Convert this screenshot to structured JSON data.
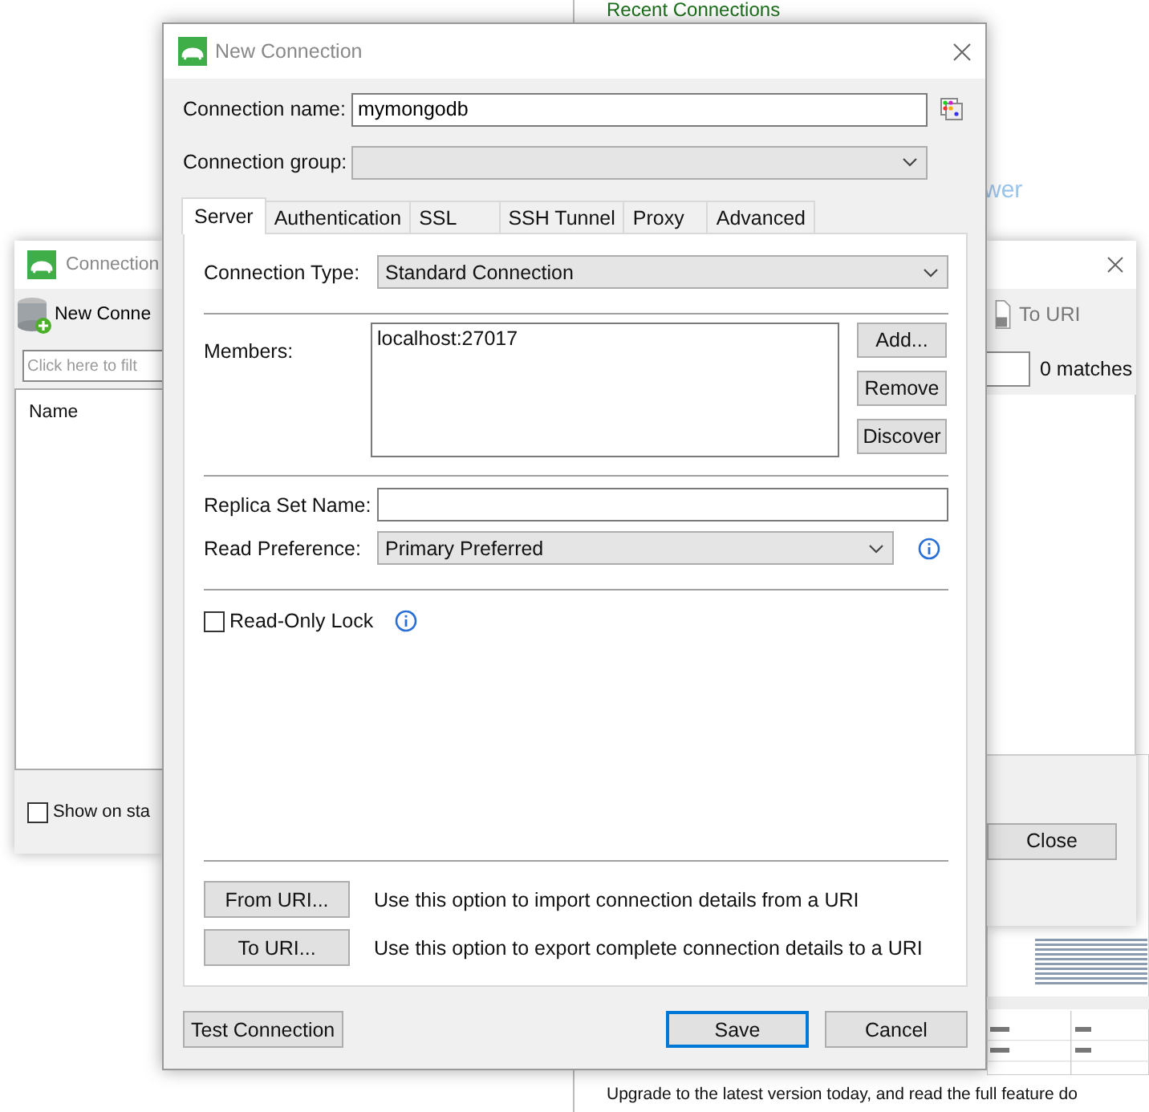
{
  "background_page": {
    "heading": "Recent Connections",
    "link": "wer",
    "footer_text": "Upgrade to the latest version today, and read the full feature do"
  },
  "connections_window": {
    "title": "Connection",
    "toolbar_button": "New Conne",
    "filter": {
      "placeholder": "Click here to filt"
    },
    "column": "Name",
    "show_on_startup": {
      "label": "Show on sta",
      "checked": false
    }
  },
  "uri_window": {
    "toolbar_button": "To URI",
    "matches": "0 matches",
    "close_button": "Close"
  },
  "dialog": {
    "title": "New Connection",
    "connection_name": {
      "label": "Connection name:",
      "value": "mymongodb"
    },
    "connection_group": {
      "label": "Connection group:"
    },
    "tabs": [
      {
        "label": "Server",
        "selected": true
      },
      {
        "label": "Authentication",
        "selected": false
      },
      {
        "label": "SSL",
        "selected": false
      },
      {
        "label": "SSH Tunnel",
        "selected": false
      },
      {
        "label": "Proxy",
        "selected": false
      },
      {
        "label": "Advanced",
        "selected": false
      }
    ],
    "connection_type": {
      "label": "Connection Type:",
      "value": "Standard Connection"
    },
    "members": {
      "label": "Members:",
      "items": [
        "localhost:27017"
      ],
      "buttons": [
        "Add...",
        "Remove",
        "Discover"
      ]
    },
    "replica_set_name": {
      "label": "Replica Set Name:"
    },
    "read_preference": {
      "label": "Read Preference:",
      "value": "Primary Preferred"
    },
    "read_only_lock": {
      "label": "Read-Only Lock",
      "checked": false
    },
    "uri_actions": [
      {
        "button": "From URI...",
        "description": "Use this option to import connection details from a URI"
      },
      {
        "button": "To URI...",
        "description": "Use this option to export complete connection details to a URI"
      }
    ],
    "buttons": [
      {
        "label": "Test Connection",
        "default": false
      },
      {
        "label": "Save",
        "default": true
      },
      {
        "label": "Cancel",
        "default": false
      }
    ]
  }
}
